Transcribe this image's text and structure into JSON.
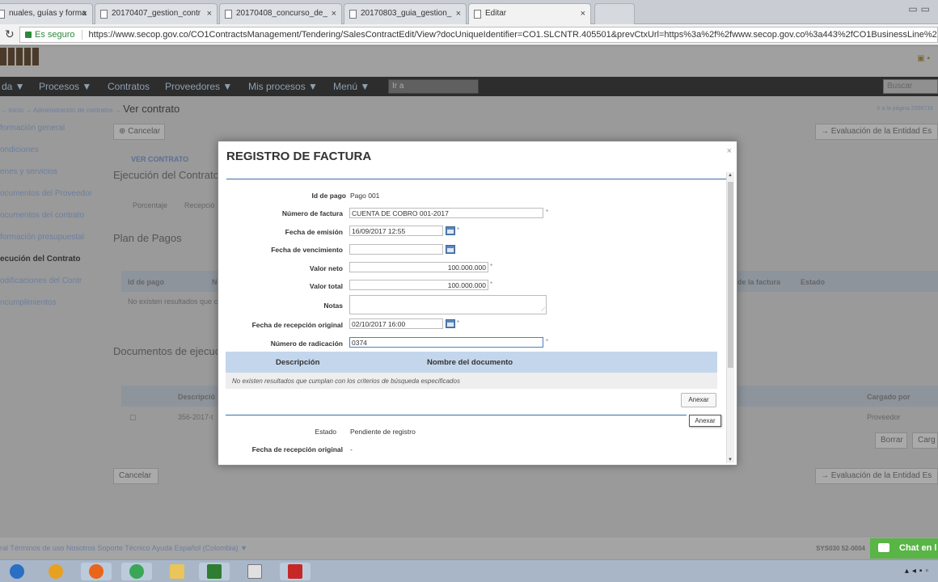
{
  "browser": {
    "tabs": [
      {
        "label": "nuales, guías y forma"
      },
      {
        "label": "20170407_gestion_contr"
      },
      {
        "label": "20170408_concurso_de_"
      },
      {
        "label": "20170803_guia_gestion_"
      },
      {
        "label": "Editar"
      }
    ],
    "secure_label": "Es seguro",
    "url": "https://www.secop.gov.co/CO1ContractsManagement/Tendering/SalesContractEdit/View?docUniqueIdentifier=CO1.SLCNTR.405501&prevCtxUrl=https%3a%2f%2fwww.secop.gov.co%3a443%2fCO1BusinessLine%2"
  },
  "background_page": {
    "nav": [
      "da ▼",
      "Procesos ▼",
      "Contratos",
      "Proveedores ▼",
      "Mis procesos ▼",
      "Menú ▼"
    ],
    "nav_select": "Ir a",
    "nav_search": "Buscar",
    "breadcrumb_prefix": "→ Inicio → Administración de contratos →",
    "breadcrumb_current": "Ver contrato",
    "breadcrumb_right": "Ir a la página 2556718",
    "sidebar": [
      "formación general",
      "ondiciones",
      "enes y servicios",
      "ocumentos del Proveedor",
      "ocumentos del contrato",
      "formación presupuestal",
      "ecución del Contrato",
      "odificaciones del Contr",
      "ncumplimientos"
    ],
    "sidebar_active_index": 6,
    "back_button": "Cancelar",
    "ver_contrato": "VER CONTRATO",
    "ejecucion_title": "Ejecución del Contrato",
    "sub_tabs": [
      "Porcentaje",
      "Recepció"
    ],
    "plan_pagos": "Plan de Pagos",
    "plan_cols": [
      "Id de pago",
      "N",
      "de la factura",
      "Estado"
    ],
    "plan_empty": "No existen resultados que cu",
    "documentos_title": "Documentos de ejecució",
    "doc_cols": [
      "Descripció",
      "Cargado por"
    ],
    "doc_row": [
      "356-2017-t",
      "Proveedor"
    ],
    "borrar": "Borrar",
    "cargar": "Carg",
    "cancel_bottom": "Cancelar",
    "evaluacion": "Evaluación de la Entidad Es",
    "footer_links": "ral  Términos de uso  Nosotros  Soporte Técnico  Ayuda  Español (Colombia) ▼",
    "footer_right": "SYS030 52-0004",
    "chat": "Chat en l"
  },
  "modal": {
    "title": "REGISTRO DE FACTURA",
    "close": "×",
    "fields": {
      "id_pago": {
        "label": "Id de pago",
        "value": "Pago 001"
      },
      "numero_factura": {
        "label": "Número de factura",
        "value": "CUENTA DE COBRO 001-2017"
      },
      "fecha_emision": {
        "label": "Fecha de emisión",
        "value": "16/09/2017 12:55"
      },
      "fecha_vencimiento": {
        "label": "Fecha de vencimiento",
        "value": ""
      },
      "valor_neto": {
        "label": "Valor neto",
        "value": "100.000.000"
      },
      "valor_total": {
        "label": "Valor total",
        "value": "100.000.000"
      },
      "notas": {
        "label": "Notas",
        "value": ""
      },
      "fecha_recepcion": {
        "label": "Fecha de recepción original",
        "value": "02/10/2017 16:00"
      },
      "numero_radicacion": {
        "label": "Número de radicación",
        "value": "0374"
      }
    },
    "required_mark": "*",
    "documents": {
      "col_descripcion": "Descripción",
      "col_nombre": "Nombre del documento",
      "empty": "No existen resultados que cumplan con los criterios de búsqueda especificados"
    },
    "anexar": "Anexar",
    "tooltip": "Anexar",
    "estado": {
      "label": "Estado",
      "value": "Pendiente de registro"
    },
    "fecha_recepcion_2": {
      "label": "Fecha de recepción original",
      "value": "-"
    }
  }
}
